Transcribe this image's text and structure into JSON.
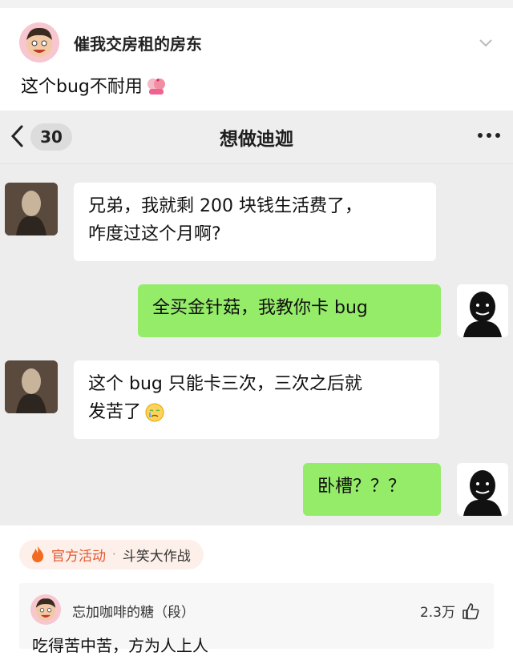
{
  "post": {
    "author": "催我交房租的房东",
    "text": "这个bug不耐用"
  },
  "chat": {
    "back_count": "30",
    "title": "想做迪迦",
    "messages": [
      {
        "side": "left",
        "line1": "兄弟，我就剩 200 块钱生活费了，",
        "line2": "咋度过这个月啊?"
      },
      {
        "side": "right",
        "line1": "全买金针菇，我教你卡 bug"
      },
      {
        "side": "left",
        "line1": "这个 bug 只能卡三次，三次之后就",
        "line2": "发苦了"
      },
      {
        "side": "right",
        "line1": "卧槽？？？"
      }
    ]
  },
  "activity": {
    "label": "官方活动",
    "separator": "·",
    "topic": "斗笑大作战"
  },
  "comment": {
    "author": "忘加咖啡的糖（段）",
    "likes": "2.3万",
    "text": "吃得苦中苦，方为人上人"
  },
  "colors": {
    "bubble_green": "#95ec69",
    "activity_orange": "#e4572e"
  }
}
